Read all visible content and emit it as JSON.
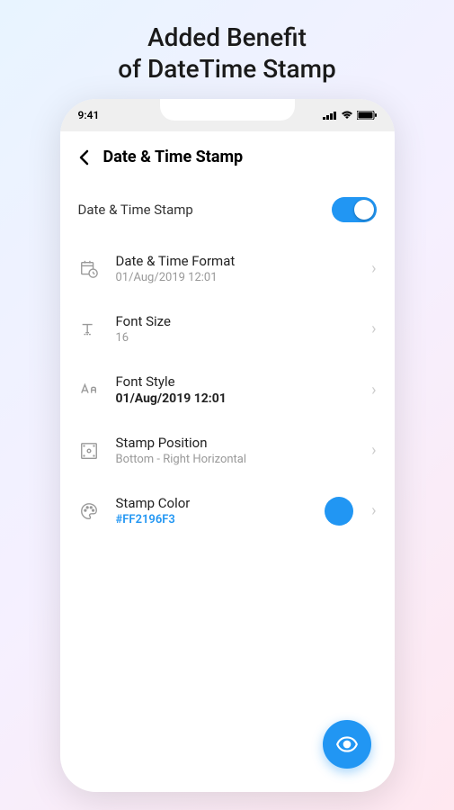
{
  "promo": {
    "line1": "Added Benefit",
    "line2": "of DateTime Stamp"
  },
  "status": {
    "time": "9:41"
  },
  "header": {
    "title": "Date & Time Stamp"
  },
  "toggle": {
    "label": "Date & Time Stamp",
    "on": true
  },
  "settings": {
    "format": {
      "title": "Date & Time Format",
      "value": "01/Aug/2019 12:01"
    },
    "fontSize": {
      "title": "Font Size",
      "value": "16"
    },
    "fontStyle": {
      "title": "Font Style",
      "value": "01/Aug/2019 12:01"
    },
    "position": {
      "title": "Stamp Position",
      "value": "Bottom - Right Horizontal"
    },
    "color": {
      "title": "Stamp Color",
      "value": "#FF2196F3",
      "swatch": "#2196f3"
    }
  }
}
